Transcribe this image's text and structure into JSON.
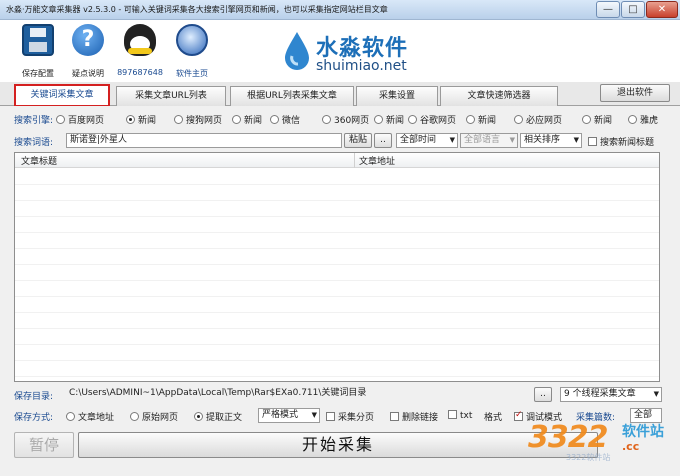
{
  "window": {
    "title": "水淼·万能文章采集器 v2.5.3.0 - 可输入关键词采集各大搜索引擎网页和新闻，也可以采集指定网站栏目文章",
    "minimize": "—",
    "maximize": "□",
    "close": "✕"
  },
  "toolbar": {
    "save": "保存配置",
    "help": "疑点说明",
    "help_glyph": "?",
    "qq": "897687648",
    "home": "软件主页"
  },
  "logo": {
    "cn": "水淼软件",
    "en": "shuimiao.net"
  },
  "tabs": [
    {
      "label": "关键词采集文章",
      "active": true
    },
    {
      "label": "采集文章URL列表"
    },
    {
      "label": "根据URL列表采集文章"
    },
    {
      "label": "采集设置"
    },
    {
      "label": "文章快速筛选器"
    }
  ],
  "exit_label": "退出软件",
  "engine": {
    "label": "搜索引擎:",
    "options": [
      "百度网页",
      "新闻",
      "搜狗网页",
      "新闻",
      "微信",
      "360网页",
      "新闻",
      "谷歌网页",
      "新闻",
      "必应网页",
      "新闻",
      "雅虎"
    ],
    "selected_index": 1
  },
  "keywords": {
    "label": "搜索词语:",
    "value": "斯诺登|外星人",
    "paste": "粘贴",
    "more": "..",
    "time": "全部时间",
    "lang": "全部语言",
    "sort": "相关排序",
    "news_title": "搜索新闻标题"
  },
  "list": {
    "col_title": "文章标题",
    "col_url": "文章地址"
  },
  "save": {
    "label": "保存目录:",
    "path": "C:\\Users\\ADMINI~1\\AppData\\Local\\Temp\\Rar$EXa0.711\\关键词目录",
    "browse": "..",
    "threads": "9 个线程采集文章"
  },
  "method": {
    "label": "保存方式:",
    "opt_url": "文章地址",
    "opt_raw": "原始网页",
    "opt_text": "提取正文",
    "mode": "严格模式",
    "split": "采集分页",
    "del_links": "删除链接",
    "txt": "txt",
    "format": "格式",
    "debug": "调试模式",
    "count_label": "采集篇数:",
    "count_value": "全部"
  },
  "pause_label": "暂停",
  "start_label": "开始采集",
  "watermark": {
    "num": "3322",
    "site": "软件站",
    "url": ".cc",
    "faded": "3322软件站"
  }
}
